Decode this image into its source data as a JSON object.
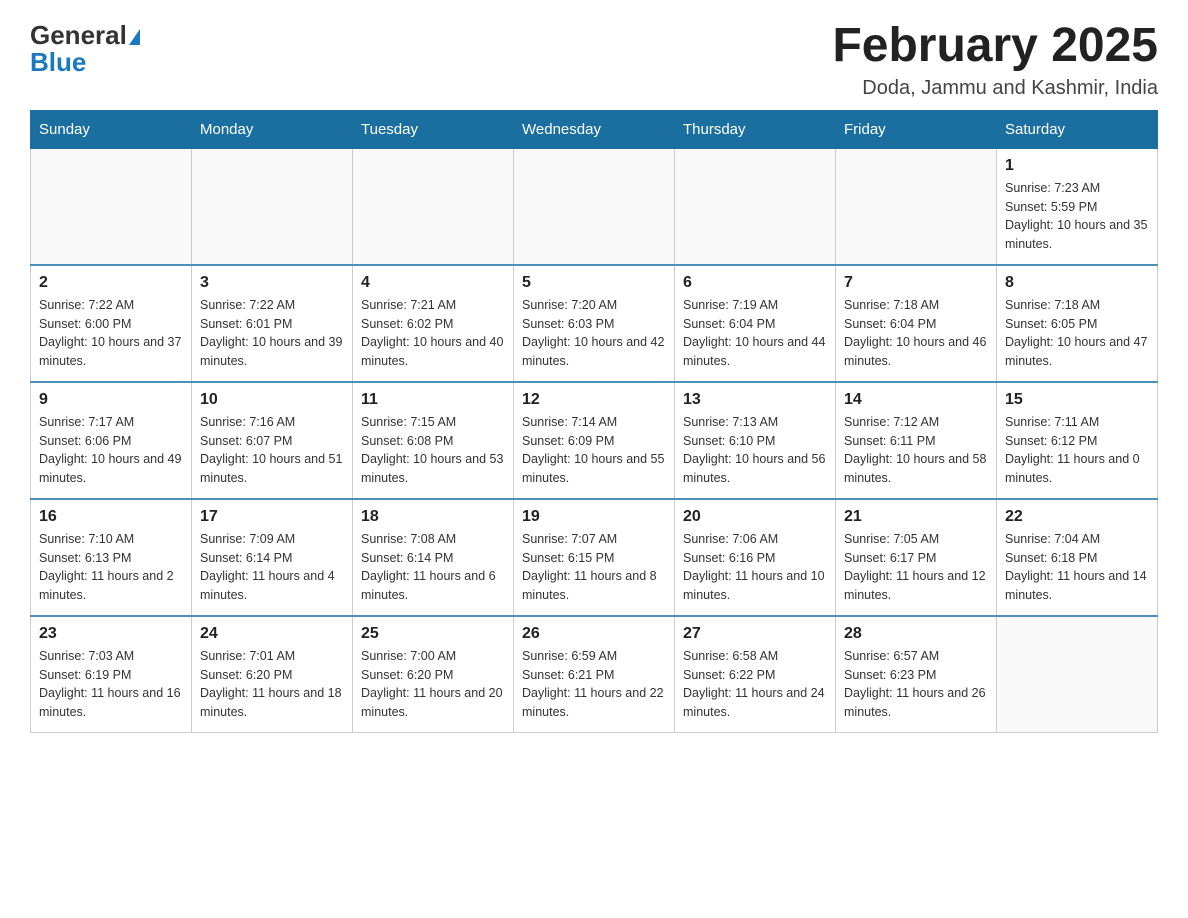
{
  "header": {
    "logo_general": "General",
    "logo_blue": "Blue",
    "title": "February 2025",
    "location": "Doda, Jammu and Kashmir, India"
  },
  "days_of_week": [
    "Sunday",
    "Monday",
    "Tuesday",
    "Wednesday",
    "Thursday",
    "Friday",
    "Saturday"
  ],
  "weeks": [
    [
      {
        "day": "",
        "info": ""
      },
      {
        "day": "",
        "info": ""
      },
      {
        "day": "",
        "info": ""
      },
      {
        "day": "",
        "info": ""
      },
      {
        "day": "",
        "info": ""
      },
      {
        "day": "",
        "info": ""
      },
      {
        "day": "1",
        "info": "Sunrise: 7:23 AM\nSunset: 5:59 PM\nDaylight: 10 hours and 35 minutes."
      }
    ],
    [
      {
        "day": "2",
        "info": "Sunrise: 7:22 AM\nSunset: 6:00 PM\nDaylight: 10 hours and 37 minutes."
      },
      {
        "day": "3",
        "info": "Sunrise: 7:22 AM\nSunset: 6:01 PM\nDaylight: 10 hours and 39 minutes."
      },
      {
        "day": "4",
        "info": "Sunrise: 7:21 AM\nSunset: 6:02 PM\nDaylight: 10 hours and 40 minutes."
      },
      {
        "day": "5",
        "info": "Sunrise: 7:20 AM\nSunset: 6:03 PM\nDaylight: 10 hours and 42 minutes."
      },
      {
        "day": "6",
        "info": "Sunrise: 7:19 AM\nSunset: 6:04 PM\nDaylight: 10 hours and 44 minutes."
      },
      {
        "day": "7",
        "info": "Sunrise: 7:18 AM\nSunset: 6:04 PM\nDaylight: 10 hours and 46 minutes."
      },
      {
        "day": "8",
        "info": "Sunrise: 7:18 AM\nSunset: 6:05 PM\nDaylight: 10 hours and 47 minutes."
      }
    ],
    [
      {
        "day": "9",
        "info": "Sunrise: 7:17 AM\nSunset: 6:06 PM\nDaylight: 10 hours and 49 minutes."
      },
      {
        "day": "10",
        "info": "Sunrise: 7:16 AM\nSunset: 6:07 PM\nDaylight: 10 hours and 51 minutes."
      },
      {
        "day": "11",
        "info": "Sunrise: 7:15 AM\nSunset: 6:08 PM\nDaylight: 10 hours and 53 minutes."
      },
      {
        "day": "12",
        "info": "Sunrise: 7:14 AM\nSunset: 6:09 PM\nDaylight: 10 hours and 55 minutes."
      },
      {
        "day": "13",
        "info": "Sunrise: 7:13 AM\nSunset: 6:10 PM\nDaylight: 10 hours and 56 minutes."
      },
      {
        "day": "14",
        "info": "Sunrise: 7:12 AM\nSunset: 6:11 PM\nDaylight: 10 hours and 58 minutes."
      },
      {
        "day": "15",
        "info": "Sunrise: 7:11 AM\nSunset: 6:12 PM\nDaylight: 11 hours and 0 minutes."
      }
    ],
    [
      {
        "day": "16",
        "info": "Sunrise: 7:10 AM\nSunset: 6:13 PM\nDaylight: 11 hours and 2 minutes."
      },
      {
        "day": "17",
        "info": "Sunrise: 7:09 AM\nSunset: 6:14 PM\nDaylight: 11 hours and 4 minutes."
      },
      {
        "day": "18",
        "info": "Sunrise: 7:08 AM\nSunset: 6:14 PM\nDaylight: 11 hours and 6 minutes."
      },
      {
        "day": "19",
        "info": "Sunrise: 7:07 AM\nSunset: 6:15 PM\nDaylight: 11 hours and 8 minutes."
      },
      {
        "day": "20",
        "info": "Sunrise: 7:06 AM\nSunset: 6:16 PM\nDaylight: 11 hours and 10 minutes."
      },
      {
        "day": "21",
        "info": "Sunrise: 7:05 AM\nSunset: 6:17 PM\nDaylight: 11 hours and 12 minutes."
      },
      {
        "day": "22",
        "info": "Sunrise: 7:04 AM\nSunset: 6:18 PM\nDaylight: 11 hours and 14 minutes."
      }
    ],
    [
      {
        "day": "23",
        "info": "Sunrise: 7:03 AM\nSunset: 6:19 PM\nDaylight: 11 hours and 16 minutes."
      },
      {
        "day": "24",
        "info": "Sunrise: 7:01 AM\nSunset: 6:20 PM\nDaylight: 11 hours and 18 minutes."
      },
      {
        "day": "25",
        "info": "Sunrise: 7:00 AM\nSunset: 6:20 PM\nDaylight: 11 hours and 20 minutes."
      },
      {
        "day": "26",
        "info": "Sunrise: 6:59 AM\nSunset: 6:21 PM\nDaylight: 11 hours and 22 minutes."
      },
      {
        "day": "27",
        "info": "Sunrise: 6:58 AM\nSunset: 6:22 PM\nDaylight: 11 hours and 24 minutes."
      },
      {
        "day": "28",
        "info": "Sunrise: 6:57 AM\nSunset: 6:23 PM\nDaylight: 11 hours and 26 minutes."
      },
      {
        "day": "",
        "info": ""
      }
    ]
  ]
}
